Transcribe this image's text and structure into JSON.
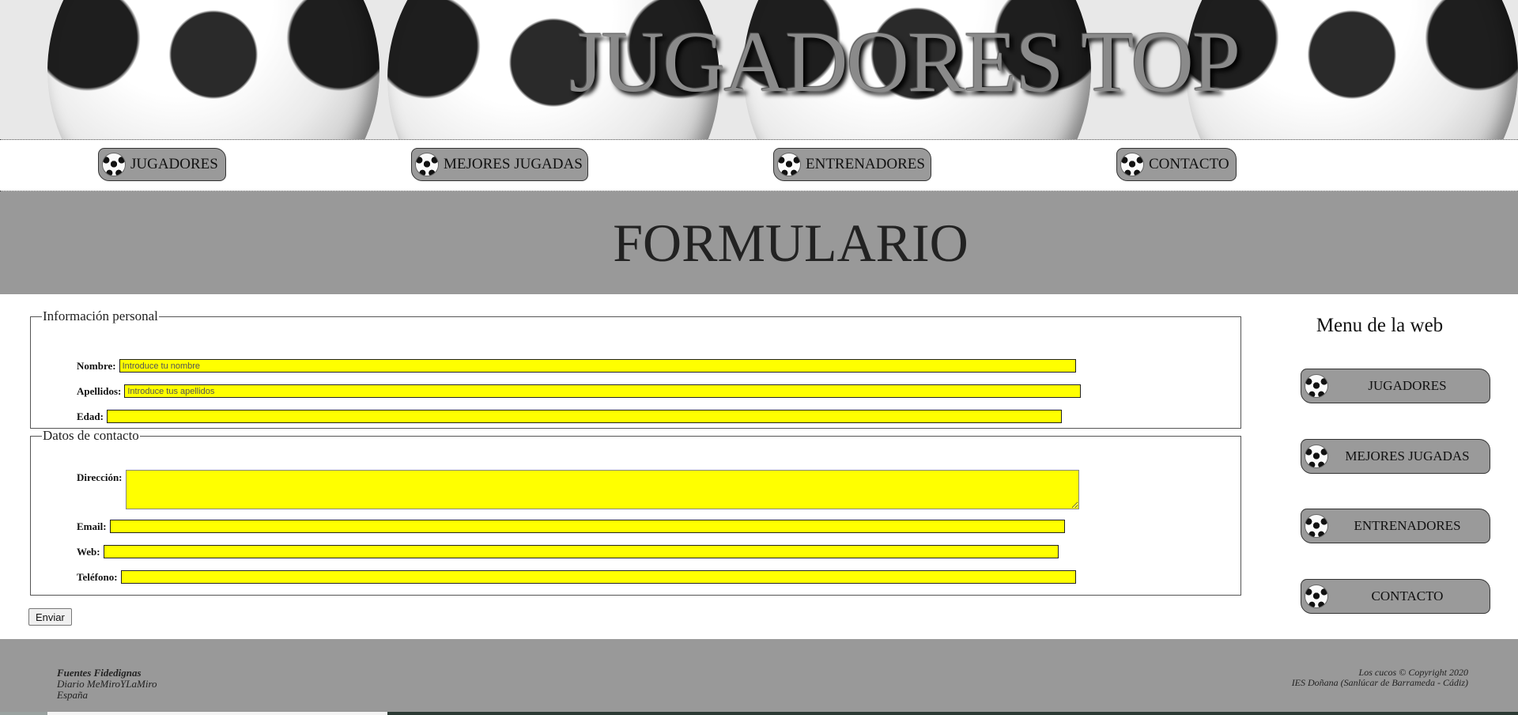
{
  "header": {
    "title": "JUGADORES TOP"
  },
  "topnav": {
    "items": [
      {
        "label": "JUGADORES",
        "icon": "soccer-ball-icon"
      },
      {
        "label": "MEJORES JUGADAS",
        "icon": "soccer-ball-icon"
      },
      {
        "label": "ENTRENADORES",
        "icon": "soccer-ball-icon"
      },
      {
        "label": "CONTACTO",
        "icon": "soccer-ball-icon"
      }
    ]
  },
  "page": {
    "title": "FORMULARIO"
  },
  "form": {
    "personal": {
      "legend": "Información personal",
      "nombre_label": "Nombre:",
      "nombre_placeholder": "Introduce tu nombre",
      "nombre_value": "",
      "apellidos_label": "Apellidos:",
      "apellidos_placeholder": "Introduce tus apellidos",
      "apellidos_value": "",
      "edad_label": "Edad:",
      "edad_value": ""
    },
    "contacto": {
      "legend": "Datos de contacto",
      "direccion_label": "Dirección:",
      "direccion_value": "",
      "email_label": "Email:",
      "email_value": "",
      "web_label": "Web:",
      "web_value": "",
      "telefono_label": "Teléfono:",
      "telefono_value": ""
    },
    "submit_label": "Enviar"
  },
  "sidebar": {
    "title": "Menu de la web",
    "items": [
      {
        "label": "JUGADORES",
        "icon": "soccer-ball-icon"
      },
      {
        "label": "MEJORES JUGADAS",
        "icon": "soccer-ball-icon"
      },
      {
        "label": "ENTRENADORES",
        "icon": "soccer-ball-icon"
      },
      {
        "label": "CONTACTO",
        "icon": "soccer-ball-icon"
      }
    ]
  },
  "footer": {
    "left": {
      "heading": "Fuentes Fidedignas",
      "line1": "Diario MeMiroYLaMiro",
      "line2": "España"
    },
    "right": {
      "line1": "Los cucos © Copyright 2020",
      "line2": "IES Doñana (Sanlúcar de Barrameda - Cádiz)"
    }
  },
  "colors": {
    "input_bg": "#ffff00",
    "band_gray": "#999999",
    "button_gray": "#9a9a9a"
  }
}
